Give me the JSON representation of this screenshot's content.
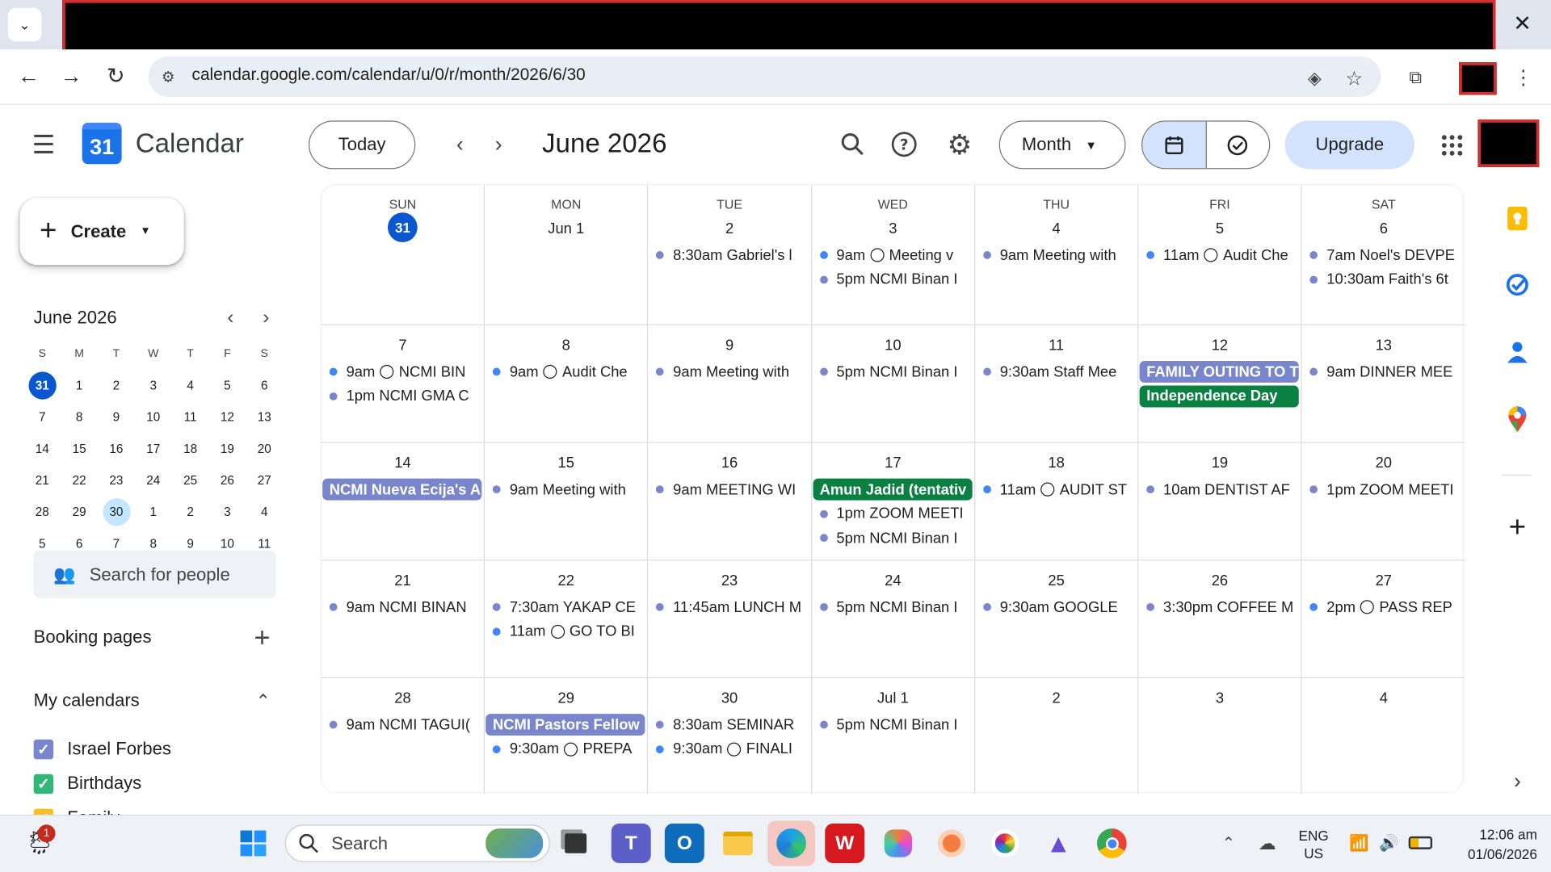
{
  "browser": {
    "url": "calendar.google.com/calendar/u/0/r/month/2026/6/30"
  },
  "header": {
    "app_title": "Calendar",
    "logo_text": "31",
    "today_label": "Today",
    "month_title": "June 2026",
    "view_label": "Month",
    "upgrade_label": "Upgrade"
  },
  "sidebar": {
    "create_label": "Create",
    "mini_title": "June 2026",
    "mini_headers": [
      "S",
      "M",
      "T",
      "W",
      "T",
      "F",
      "S"
    ],
    "mini_weeks": [
      [
        "31",
        "1",
        "2",
        "3",
        "4",
        "5",
        "6"
      ],
      [
        "7",
        "8",
        "9",
        "10",
        "11",
        "12",
        "13"
      ],
      [
        "14",
        "15",
        "16",
        "17",
        "18",
        "19",
        "20"
      ],
      [
        "21",
        "22",
        "23",
        "24",
        "25",
        "26",
        "27"
      ],
      [
        "28",
        "29",
        "30",
        "1",
        "2",
        "3",
        "4"
      ],
      [
        "5",
        "6",
        "7",
        "8",
        "9",
        "10",
        "11"
      ]
    ],
    "search_people": "Search for people",
    "booking_pages": "Booking pages",
    "my_calendars": "My calendars",
    "calendars": [
      {
        "name": "Israel Forbes",
        "color": "#7986cb"
      },
      {
        "name": "Birthdays",
        "color": "#33b679"
      },
      {
        "name": "Family",
        "color": "#f6bf26"
      }
    ]
  },
  "grid": {
    "day_headers": [
      "SUN",
      "MON",
      "TUE",
      "WED",
      "THU",
      "FRI",
      "SAT"
    ],
    "weeks": [
      [
        {
          "num": "31",
          "today": true,
          "events": []
        },
        {
          "num": "Jun 1",
          "events": []
        },
        {
          "num": "2",
          "events": [
            {
              "type": "dot",
              "color": "#7986cb",
              "text": "8:30am Gabriel's l"
            }
          ]
        },
        {
          "num": "3",
          "events": [
            {
              "type": "task",
              "color": "#4285f4",
              "time": "9am",
              "text": "Meeting v"
            },
            {
              "type": "dot",
              "color": "#7986cb",
              "text": "5pm NCMI Binan I"
            }
          ]
        },
        {
          "num": "4",
          "events": [
            {
              "type": "dot",
              "color": "#7986cb",
              "text": "9am Meeting with"
            }
          ]
        },
        {
          "num": "5",
          "events": [
            {
              "type": "task",
              "color": "#4285f4",
              "time": "11am",
              "text": "Audit Che"
            }
          ]
        },
        {
          "num": "6",
          "events": [
            {
              "type": "dot",
              "color": "#7986cb",
              "text": "7am Noel's DEVPE"
            },
            {
              "type": "dot",
              "color": "#7986cb",
              "text": "10:30am Faith's 6t"
            }
          ]
        }
      ],
      [
        {
          "num": "7",
          "events": [
            {
              "type": "task",
              "color": "#4285f4",
              "time": "9am",
              "text": "NCMI BIN"
            },
            {
              "type": "dot",
              "color": "#7986cb",
              "text": "1pm NCMI GMA C"
            }
          ]
        },
        {
          "num": "8",
          "events": [
            {
              "type": "task",
              "color": "#4285f4",
              "time": "9am",
              "text": "Audit Che"
            }
          ]
        },
        {
          "num": "9",
          "events": [
            {
              "type": "dot",
              "color": "#7986cb",
              "text": "9am Meeting with"
            }
          ]
        },
        {
          "num": "10",
          "events": [
            {
              "type": "dot",
              "color": "#7986cb",
              "text": "5pm NCMI Binan I"
            }
          ]
        },
        {
          "num": "11",
          "events": [
            {
              "type": "dot",
              "color": "#7986cb",
              "text": "9:30am Staff Mee"
            }
          ]
        },
        {
          "num": "12",
          "events": [
            {
              "type": "chip",
              "color": "#7986cb",
              "text": "FAMILY OUTING TO T"
            },
            {
              "type": "chip",
              "color": "#0b8043",
              "text": "Independence Day"
            }
          ]
        },
        {
          "num": "13",
          "events": [
            {
              "type": "dot",
              "color": "#7986cb",
              "text": "9am DINNER MEE"
            }
          ]
        }
      ],
      [
        {
          "num": "14",
          "events": [
            {
              "type": "chip",
              "color": "#7986cb",
              "text": "NCMI Nueva Ecija's A"
            }
          ]
        },
        {
          "num": "15",
          "events": [
            {
              "type": "dot",
              "color": "#7986cb",
              "text": "9am Meeting with"
            }
          ]
        },
        {
          "num": "16",
          "events": [
            {
              "type": "dot",
              "color": "#7986cb",
              "text": "9am MEETING WI"
            }
          ]
        },
        {
          "num": "17",
          "events": [
            {
              "type": "chip",
              "color": "#0b8043",
              "text": "Amun Jadid (tentativ"
            },
            {
              "type": "dot",
              "color": "#7986cb",
              "text": "1pm ZOOM MEETI"
            },
            {
              "type": "dot",
              "color": "#7986cb",
              "text": "5pm NCMI Binan I"
            }
          ]
        },
        {
          "num": "18",
          "events": [
            {
              "type": "task",
              "color": "#4285f4",
              "time": "11am",
              "text": "AUDIT ST"
            }
          ]
        },
        {
          "num": "19",
          "events": [
            {
              "type": "dot",
              "color": "#7986cb",
              "text": "10am DENTIST AF"
            }
          ]
        },
        {
          "num": "20",
          "events": [
            {
              "type": "dot",
              "color": "#7986cb",
              "text": "1pm ZOOM MEETI"
            }
          ]
        }
      ],
      [
        {
          "num": "21",
          "events": [
            {
              "type": "dot",
              "color": "#7986cb",
              "text": "9am NCMI BINAN"
            }
          ]
        },
        {
          "num": "22",
          "events": [
            {
              "type": "dot",
              "color": "#7986cb",
              "text": "7:30am YAKAP CE"
            },
            {
              "type": "task",
              "color": "#4285f4",
              "time": "11am",
              "text": "GO TO BI"
            }
          ]
        },
        {
          "num": "23",
          "events": [
            {
              "type": "dot",
              "color": "#7986cb",
              "text": "11:45am LUNCH M"
            }
          ]
        },
        {
          "num": "24",
          "events": [
            {
              "type": "dot",
              "color": "#7986cb",
              "text": "5pm NCMI Binan I"
            }
          ]
        },
        {
          "num": "25",
          "events": [
            {
              "type": "dot",
              "color": "#7986cb",
              "text": "9:30am GOOGLE"
            }
          ]
        },
        {
          "num": "26",
          "events": [
            {
              "type": "dot",
              "color": "#7986cb",
              "text": "3:30pm COFFEE M"
            }
          ]
        },
        {
          "num": "27",
          "events": [
            {
              "type": "task",
              "color": "#4285f4",
              "time": "2pm",
              "text": "PASS REP"
            }
          ]
        }
      ],
      [
        {
          "num": "28",
          "events": [
            {
              "type": "dot",
              "color": "#7986cb",
              "text": "9am NCMI TAGUI("
            }
          ]
        },
        {
          "num": "29",
          "events": [
            {
              "type": "chip",
              "color": "#7986cb",
              "text": "NCMI Pastors Fellow"
            },
            {
              "type": "task",
              "color": "#4285f4",
              "time": "9:30am",
              "text": "PREPA"
            }
          ]
        },
        {
          "num": "30",
          "events": [
            {
              "type": "dot",
              "color": "#7986cb",
              "text": "8:30am SEMINAR"
            },
            {
              "type": "task",
              "color": "#4285f4",
              "time": "9:30am",
              "text": "FINALI"
            }
          ]
        },
        {
          "num": "Jul 1",
          "events": [
            {
              "type": "dot",
              "color": "#7986cb",
              "text": "5pm NCMI Binan I"
            }
          ]
        },
        {
          "num": "2",
          "events": []
        },
        {
          "num": "3",
          "events": []
        },
        {
          "num": "4",
          "events": []
        }
      ]
    ]
  },
  "taskbar": {
    "search_label": "Search",
    "weather_badge": "1",
    "lang_line1": "ENG",
    "lang_line2": "US",
    "time": "12:06 am",
    "date": "01/06/2026"
  }
}
